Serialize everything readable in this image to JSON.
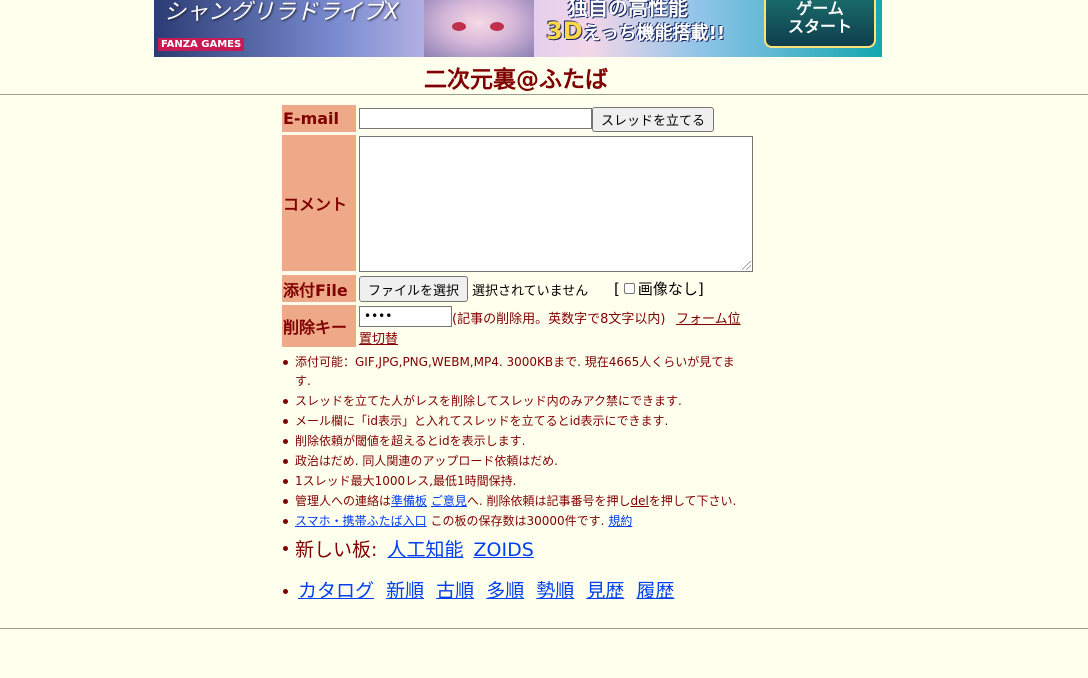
{
  "banner": {
    "game_title": "シャングリラドライブX",
    "publisher": "FANZA GAMES",
    "tagline_top": "独自の高性能",
    "tagline_3d": "3D",
    "tagline_rest": "えっち機能搭載!!",
    "start_button": "ゲーム\nスタート"
  },
  "page_title": "二次元裏@ふたば",
  "form": {
    "email_label": "E-mail",
    "email_value": "",
    "submit_label": "スレッドを立てる",
    "comment_label": "コメント",
    "file_label": "添付File",
    "file_button": "ファイルを選択",
    "file_status": "選択されていません",
    "noimage_label": "画像なし",
    "noimage_open": "[",
    "noimage_close": "]",
    "delkey_label": "削除キー",
    "delkey_value": "••••",
    "delkey_note": "(記事の削除用。英数字で8文字以内)",
    "form_switch_1": "フォーム位",
    "form_switch_2": "置切替"
  },
  "rules": {
    "r1": "添付可能：GIF,JPG,PNG,WEBM,MP4. 3000KBまで. 現在4665人くらいが見てま",
    "r1b": "す.",
    "r2": "スレッドを立てた人がレスを削除してスレッド内のみアク禁にできます.",
    "r3": "メール欄に「id表示」と入れてスレッドを立てるとid表示にできます.",
    "r4": "削除依頼が閾値を超えるとidを表示します.",
    "r5": "政治はだめ. 同人関連のアップロード依頼はだめ.",
    "r6": "1スレッド最大1000レス,最低1時間保持.",
    "r7_pre": "管理人への連絡は",
    "r7_link1": "準備板",
    "r7_link2": "ご意見",
    "r7_mid": "へ. 削除依頼は記事番号を押し",
    "r7_link3": "del",
    "r7_post": "を押して下さい.",
    "r8_link": "スマホ・携帯ふたば入口",
    "r8_mid": "この板の保存数は30000件です.",
    "r8_link2": "規約"
  },
  "new_boards": {
    "label": "新しい板:",
    "links": [
      "人工知能",
      "ZOIDS"
    ]
  },
  "catalog_nav": [
    "カタログ",
    "新順",
    "古順",
    "多順",
    "勢順",
    "見歴",
    "履歴"
  ],
  "colors": {
    "background": "#ffffee",
    "text": "#800000",
    "label_bg": "#eeaa88",
    "link": "#0040ee"
  }
}
